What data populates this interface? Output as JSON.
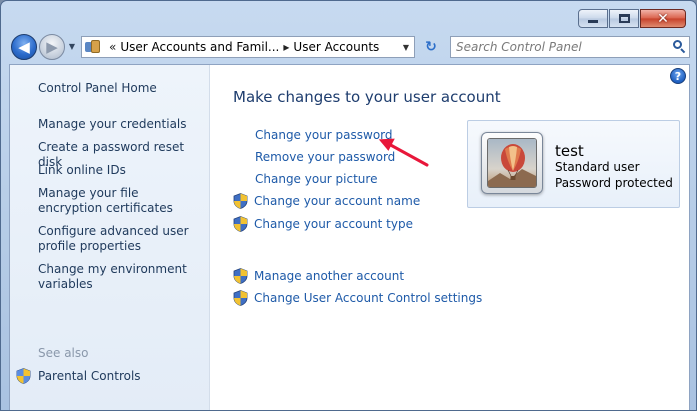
{
  "window": {
    "caption_buttons": [
      "minimize",
      "maximize",
      "close"
    ],
    "close_glyph": "✕"
  },
  "navigation": {
    "back_glyph": "◀",
    "forward_glyph": "▶",
    "recent_glyph": "▼",
    "address": {
      "overflow_glyph": "«",
      "crumbs": [
        "User Accounts and Famil...",
        "User Accounts"
      ],
      "separator": "▸",
      "dropdown_glyph": "▼"
    },
    "refresh_glyph": "↻",
    "search": {
      "placeholder": "Search Control Panel"
    }
  },
  "sidebar": {
    "home_label": "Control Panel Home",
    "items": [
      "Manage your credentials",
      "Create a password reset disk",
      "Link online IDs",
      "Manage your file encryption certificates",
      "Configure advanced user profile properties",
      "Change my environment variables"
    ],
    "see_also_label": "See also",
    "see_also_items": [
      "Parental Controls"
    ]
  },
  "main": {
    "help_glyph": "?",
    "title": "Make changes to your user account",
    "links": [
      {
        "label": "Change your password",
        "shield": false
      },
      {
        "label": "Remove your password",
        "shield": false
      },
      {
        "label": "Change your picture",
        "shield": false
      },
      {
        "label": "Change your account name",
        "shield": true
      },
      {
        "label": "Change your account type",
        "shield": true
      }
    ],
    "other_links": [
      {
        "label": "Manage another account",
        "shield": true
      },
      {
        "label": "Change User Account Control settings",
        "shield": true
      }
    ]
  },
  "account": {
    "name": "test",
    "type": "Standard user",
    "status": "Password protected",
    "picture": "hot-air-balloon"
  },
  "annotation": {
    "arrow_color": "#e8173a",
    "points_to": "Change your password"
  },
  "colors": {
    "link": "#1e5aa8",
    "title": "#1e3d6e",
    "sidebar_text": "#1e395b",
    "see_also": "#8a98ab"
  }
}
